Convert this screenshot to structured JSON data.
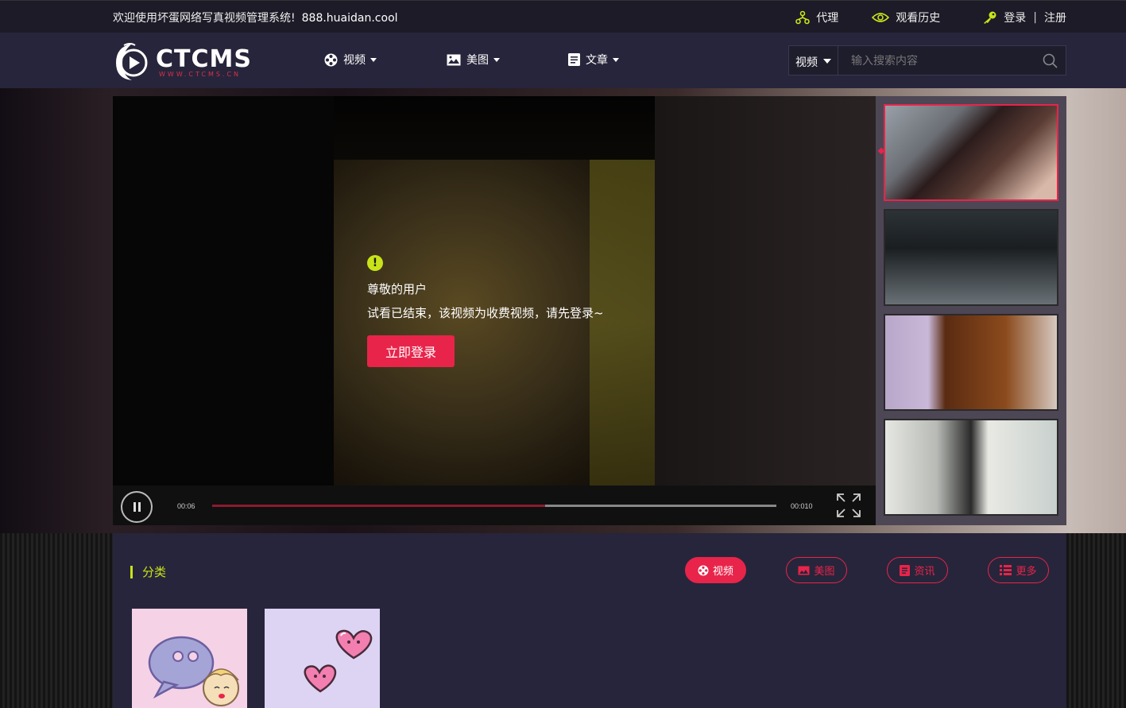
{
  "topbar": {
    "welcome": "欢迎使用坏蛋网络写真视频管理系统!",
    "domain": "888.huaidan.cool",
    "links": {
      "agent": "代理",
      "history": "观看历史",
      "login": "登录",
      "separator": "|",
      "register": "注册"
    }
  },
  "header": {
    "logo_text": "CTCMS",
    "logo_sub": "WWW.CTCMS.CN",
    "nav": {
      "video": "视频",
      "images": "美图",
      "articles": "文章"
    },
    "search": {
      "category": "视频",
      "placeholder": "输入搜索内容"
    }
  },
  "player": {
    "message_title": "尊敬的用户",
    "message_body": "试看已结束，该视频为收费视频，请先登录~",
    "login_button": "立即登录",
    "current_time": "00:06",
    "total_time": "00:010",
    "progress": 0.59
  },
  "section": {
    "title": "分类",
    "tabs": {
      "video": "视频",
      "images": "美图",
      "news": "资讯",
      "more": "更多"
    }
  },
  "colors": {
    "accent": "#e8244a",
    "highlight": "#c8e319",
    "header_bg": "#27253b",
    "topbar_bg": "#1c1b27"
  }
}
